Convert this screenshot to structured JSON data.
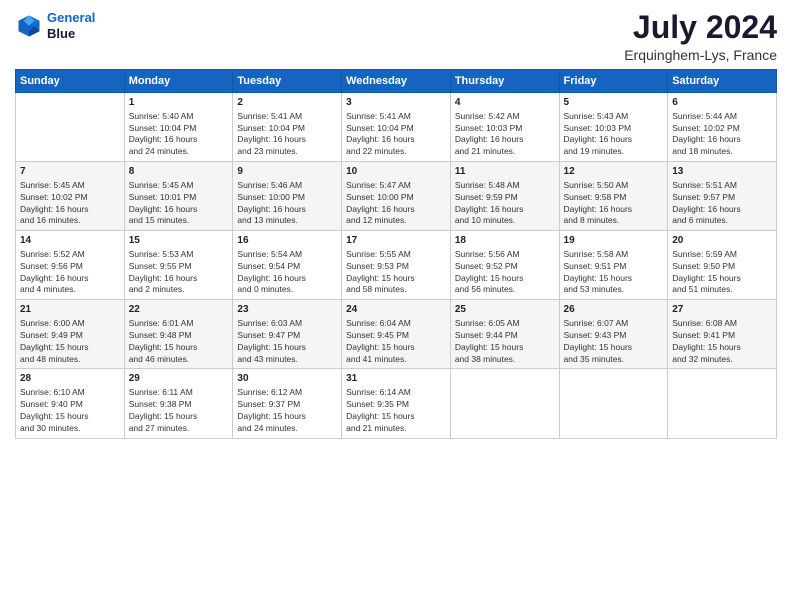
{
  "header": {
    "logo_line1": "General",
    "logo_line2": "Blue",
    "title": "July 2024",
    "subtitle": "Erquinghem-Lys, France"
  },
  "days_of_week": [
    "Sunday",
    "Monday",
    "Tuesday",
    "Wednesday",
    "Thursday",
    "Friday",
    "Saturday"
  ],
  "weeks": [
    [
      {
        "num": "",
        "info": ""
      },
      {
        "num": "1",
        "info": "Sunrise: 5:40 AM\nSunset: 10:04 PM\nDaylight: 16 hours\nand 24 minutes."
      },
      {
        "num": "2",
        "info": "Sunrise: 5:41 AM\nSunset: 10:04 PM\nDaylight: 16 hours\nand 23 minutes."
      },
      {
        "num": "3",
        "info": "Sunrise: 5:41 AM\nSunset: 10:04 PM\nDaylight: 16 hours\nand 22 minutes."
      },
      {
        "num": "4",
        "info": "Sunrise: 5:42 AM\nSunset: 10:03 PM\nDaylight: 16 hours\nand 21 minutes."
      },
      {
        "num": "5",
        "info": "Sunrise: 5:43 AM\nSunset: 10:03 PM\nDaylight: 16 hours\nand 19 minutes."
      },
      {
        "num": "6",
        "info": "Sunrise: 5:44 AM\nSunset: 10:02 PM\nDaylight: 16 hours\nand 18 minutes."
      }
    ],
    [
      {
        "num": "7",
        "info": "Sunrise: 5:45 AM\nSunset: 10:02 PM\nDaylight: 16 hours\nand 16 minutes."
      },
      {
        "num": "8",
        "info": "Sunrise: 5:45 AM\nSunset: 10:01 PM\nDaylight: 16 hours\nand 15 minutes."
      },
      {
        "num": "9",
        "info": "Sunrise: 5:46 AM\nSunset: 10:00 PM\nDaylight: 16 hours\nand 13 minutes."
      },
      {
        "num": "10",
        "info": "Sunrise: 5:47 AM\nSunset: 10:00 PM\nDaylight: 16 hours\nand 12 minutes."
      },
      {
        "num": "11",
        "info": "Sunrise: 5:48 AM\nSunset: 9:59 PM\nDaylight: 16 hours\nand 10 minutes."
      },
      {
        "num": "12",
        "info": "Sunrise: 5:50 AM\nSunset: 9:58 PM\nDaylight: 16 hours\nand 8 minutes."
      },
      {
        "num": "13",
        "info": "Sunrise: 5:51 AM\nSunset: 9:57 PM\nDaylight: 16 hours\nand 6 minutes."
      }
    ],
    [
      {
        "num": "14",
        "info": "Sunrise: 5:52 AM\nSunset: 9:56 PM\nDaylight: 16 hours\nand 4 minutes."
      },
      {
        "num": "15",
        "info": "Sunrise: 5:53 AM\nSunset: 9:55 PM\nDaylight: 16 hours\nand 2 minutes."
      },
      {
        "num": "16",
        "info": "Sunrise: 5:54 AM\nSunset: 9:54 PM\nDaylight: 16 hours\nand 0 minutes."
      },
      {
        "num": "17",
        "info": "Sunrise: 5:55 AM\nSunset: 9:53 PM\nDaylight: 15 hours\nand 58 minutes."
      },
      {
        "num": "18",
        "info": "Sunrise: 5:56 AM\nSunset: 9:52 PM\nDaylight: 15 hours\nand 56 minutes."
      },
      {
        "num": "19",
        "info": "Sunrise: 5:58 AM\nSunset: 9:51 PM\nDaylight: 15 hours\nand 53 minutes."
      },
      {
        "num": "20",
        "info": "Sunrise: 5:59 AM\nSunset: 9:50 PM\nDaylight: 15 hours\nand 51 minutes."
      }
    ],
    [
      {
        "num": "21",
        "info": "Sunrise: 6:00 AM\nSunset: 9:49 PM\nDaylight: 15 hours\nand 48 minutes."
      },
      {
        "num": "22",
        "info": "Sunrise: 6:01 AM\nSunset: 9:48 PM\nDaylight: 15 hours\nand 46 minutes."
      },
      {
        "num": "23",
        "info": "Sunrise: 6:03 AM\nSunset: 9:47 PM\nDaylight: 15 hours\nand 43 minutes."
      },
      {
        "num": "24",
        "info": "Sunrise: 6:04 AM\nSunset: 9:45 PM\nDaylight: 15 hours\nand 41 minutes."
      },
      {
        "num": "25",
        "info": "Sunrise: 6:05 AM\nSunset: 9:44 PM\nDaylight: 15 hours\nand 38 minutes."
      },
      {
        "num": "26",
        "info": "Sunrise: 6:07 AM\nSunset: 9:43 PM\nDaylight: 15 hours\nand 35 minutes."
      },
      {
        "num": "27",
        "info": "Sunrise: 6:08 AM\nSunset: 9:41 PM\nDaylight: 15 hours\nand 32 minutes."
      }
    ],
    [
      {
        "num": "28",
        "info": "Sunrise: 6:10 AM\nSunset: 9:40 PM\nDaylight: 15 hours\nand 30 minutes."
      },
      {
        "num": "29",
        "info": "Sunrise: 6:11 AM\nSunset: 9:38 PM\nDaylight: 15 hours\nand 27 minutes."
      },
      {
        "num": "30",
        "info": "Sunrise: 6:12 AM\nSunset: 9:37 PM\nDaylight: 15 hours\nand 24 minutes."
      },
      {
        "num": "31",
        "info": "Sunrise: 6:14 AM\nSunset: 9:35 PM\nDaylight: 15 hours\nand 21 minutes."
      },
      {
        "num": "",
        "info": ""
      },
      {
        "num": "",
        "info": ""
      },
      {
        "num": "",
        "info": ""
      }
    ]
  ]
}
